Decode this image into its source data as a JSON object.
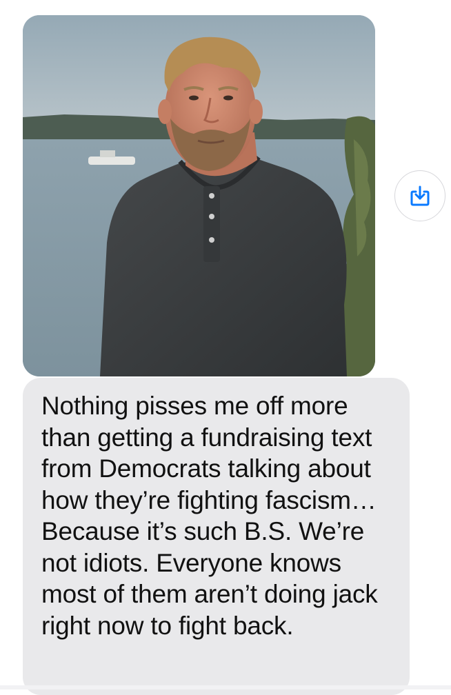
{
  "message": {
    "text": "Nothing pisses me off more than getting a fundraising text from Democrats talking about how they’re fighting fascism… Because it’s such B.S. We’re not idiots. Everyone knows most of them aren’t doing jack right now to fight back."
  },
  "photo": {
    "subject": "photo-of-man-by-water"
  },
  "actions": {
    "save_icon": "save-to-photos-icon"
  },
  "colors": {
    "bubble_gray": "#e9e9eb",
    "accent_blue": "#0a7aff",
    "text": "#111111"
  }
}
